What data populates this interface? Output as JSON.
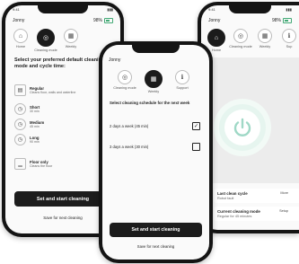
{
  "phone_left": {
    "status_time": "9:41",
    "user": "Jonny",
    "battery": "98%",
    "modes": [
      {
        "label": "Home",
        "icon": "home-icon",
        "glyph": "⌂",
        "active": false
      },
      {
        "label": "Cleaning mode",
        "icon": "cleaning-mode-icon",
        "glyph": "◎",
        "active": true
      },
      {
        "label": "Weekly",
        "icon": "calendar-icon",
        "glyph": "▦",
        "active": false
      }
    ],
    "heading": "Select your preferred default cleaning mode and cycle time:",
    "cleaning_modes": [
      {
        "title": "Regular",
        "subtitle": "Cleans floor, walls and waterline",
        "icon": "regular-icon",
        "glyph": "▤"
      },
      {
        "title": "Short",
        "subtitle": "30 min",
        "icon": "timer-icon",
        "glyph": "◷"
      },
      {
        "title": "Medium",
        "subtitle": "45 min",
        "icon": "timer-icon",
        "glyph": "◷"
      },
      {
        "title": "Long",
        "subtitle": "90 min",
        "icon": "timer-icon",
        "glyph": "◷"
      },
      {
        "title": "Floor only",
        "subtitle": "Cleans the floor",
        "icon": "floor-icon",
        "glyph": "▁"
      }
    ],
    "primary_button": "Set and start cleaning",
    "secondary_link": "Save for next cleaning"
  },
  "phone_middle": {
    "user": "Jonny",
    "modes": [
      {
        "label": "Cleaning mode",
        "icon": "cleaning-mode-icon",
        "glyph": "◎",
        "active": false
      },
      {
        "label": "Weekly",
        "icon": "calendar-icon",
        "glyph": "▦",
        "active": true
      },
      {
        "label": "Support",
        "icon": "info-icon",
        "glyph": "ℹ",
        "active": false
      }
    ],
    "heading": "Select cleaning schedule for the next week",
    "options": [
      {
        "label": "2 days a week (45 min)",
        "checked": true
      },
      {
        "label": "3 days a week (30 min)",
        "checked": false
      }
    ],
    "primary_button": "Set and start cleaning",
    "secondary_link": "Save for next cleaning"
  },
  "phone_right": {
    "status_time": "9:41",
    "user": "Jonny",
    "battery": "98%",
    "modes": [
      {
        "label": "Home",
        "icon": "home-icon",
        "glyph": "⌂",
        "active": true
      },
      {
        "label": "Cleaning mode",
        "icon": "cleaning-mode-icon",
        "glyph": "◎",
        "active": false
      },
      {
        "label": "Weekly",
        "icon": "calendar-icon",
        "glyph": "▦",
        "active": false
      },
      {
        "label": "Sup",
        "icon": "info-icon",
        "glyph": "ℹ",
        "active": false
      }
    ],
    "accent": "#9fd8c6",
    "cards": [
      {
        "title": "Last clean cycle",
        "subtitle": "Robot fault",
        "action": "More"
      },
      {
        "title": "Current cleaning mode",
        "subtitle": "Regular for 45 minutes",
        "action": "Setup"
      }
    ]
  }
}
